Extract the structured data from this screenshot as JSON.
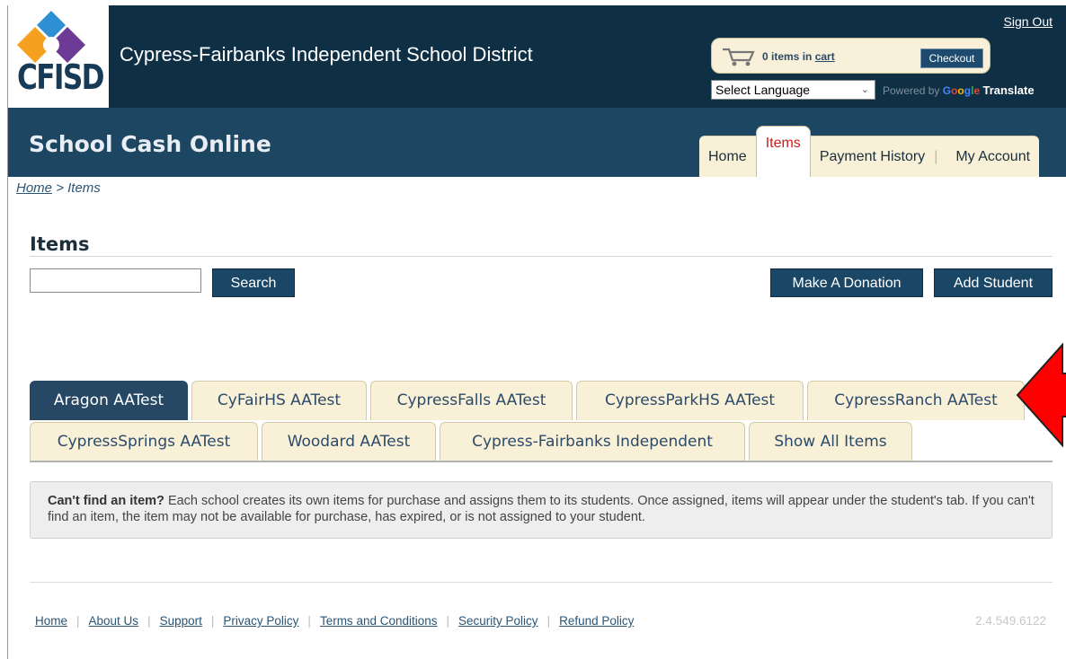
{
  "header": {
    "logo_text": "CFISD",
    "district_title": "Cypress-Fairbanks Independent School District",
    "sign_out": "Sign Out",
    "cart": {
      "count_text": "0 items in",
      "cart_link": "cart",
      "checkout": "Checkout"
    },
    "language": {
      "selected": "Select Language",
      "powered_by": "Powered by",
      "google": "Google",
      "translate": "Translate"
    }
  },
  "nav": {
    "site_name": "School Cash Online",
    "tabs": [
      {
        "label": "Home"
      },
      {
        "label": "Items",
        "active": true
      },
      {
        "label": "Payment History"
      },
      {
        "label": "My Account"
      }
    ]
  },
  "breadcrumb": {
    "home": "Home",
    "separator": ">",
    "current": "Items"
  },
  "main": {
    "title": "Items",
    "search_value": "",
    "search_button": "Search",
    "donation_button": "Make A Donation",
    "add_student_button": "Add Student",
    "school_tabs": [
      {
        "label": "Aragon AATest",
        "active": true
      },
      {
        "label": "CyFairHS AATest"
      },
      {
        "label": "CypressFalls AATest"
      },
      {
        "label": "CypressParkHS AATest"
      },
      {
        "label": "CypressRanch AATest"
      },
      {
        "label": "CypressSprings AATest"
      },
      {
        "label": "Woodard AATest"
      },
      {
        "label": "Cypress-Fairbanks Independent"
      },
      {
        "label": "Show All Items"
      }
    ],
    "notice": {
      "bold": "Can't find an item?",
      "text": " Each school creates its own items for purchase and assigns them to its students. Once assigned, items will appear under the student's tab. If you can't find an item, the item may not be available for purchase, has expired, or is not assigned to your student."
    }
  },
  "footer": {
    "links": [
      "Home",
      "About Us",
      "Support",
      "Privacy Policy",
      "Terms and Conditions",
      "Security Policy",
      "Refund Policy"
    ],
    "version": "2.4.549.6122"
  },
  "colors": {
    "header_bg": "#0f2f44",
    "nav_bg": "#1c4661",
    "tab_bg": "#f8f1d8",
    "active_tab_bg": "#264864",
    "active_nav_text": "#c91e1e",
    "annotation_arrow": "#ff0000"
  }
}
